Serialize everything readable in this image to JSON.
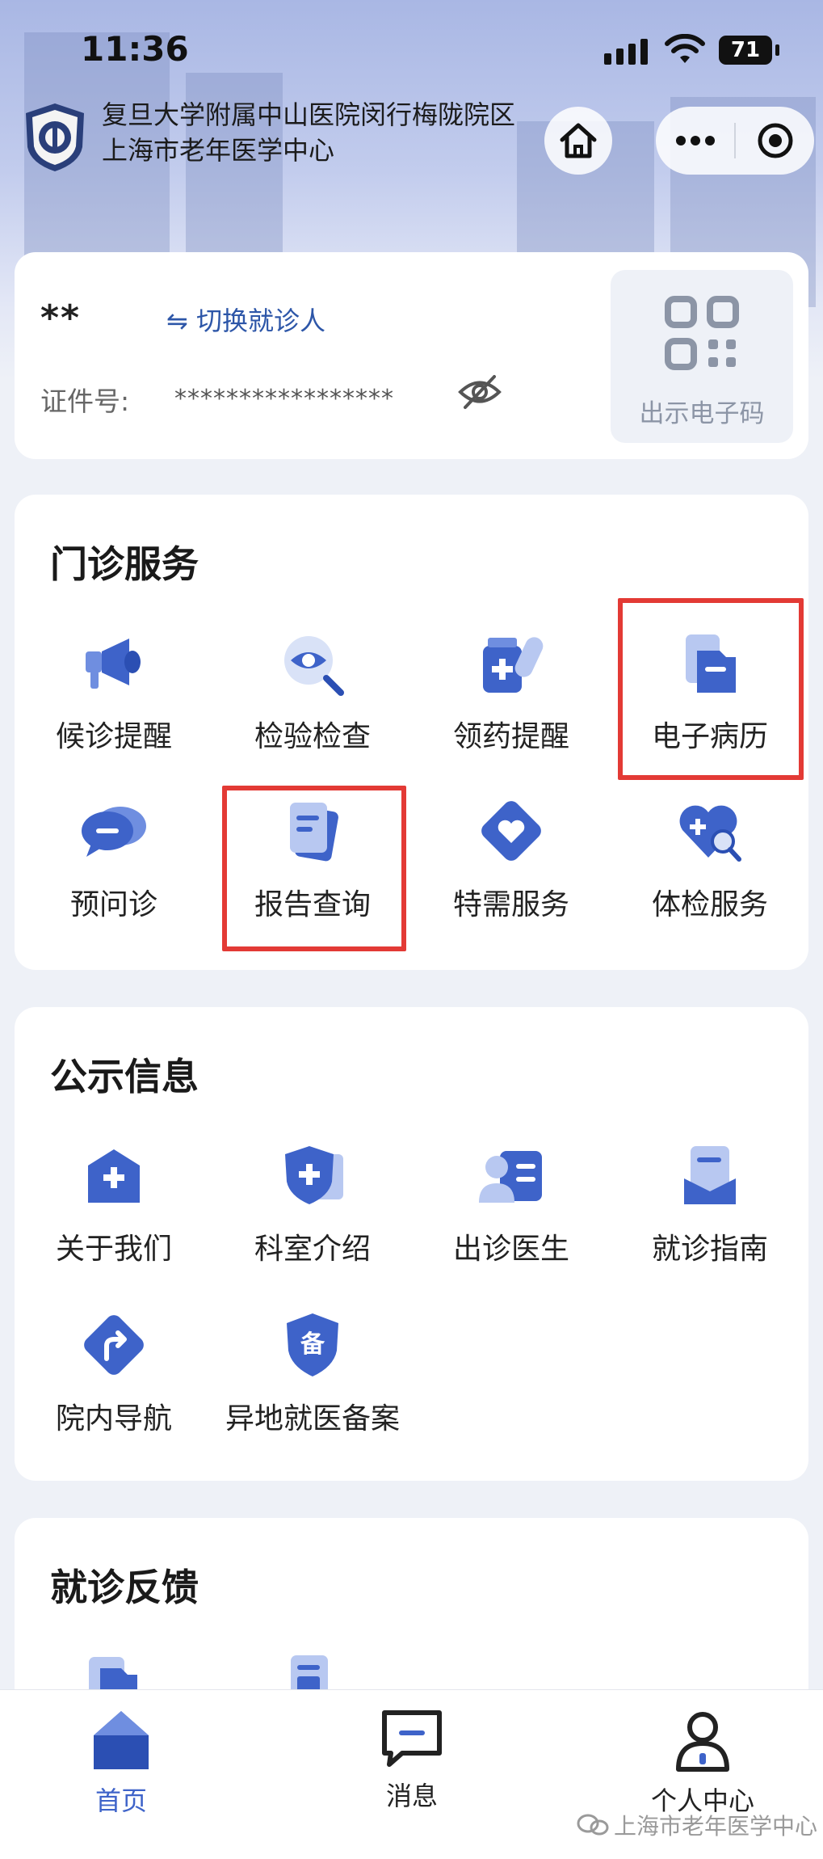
{
  "status_bar": {
    "time": "11:36",
    "battery": "71"
  },
  "header": {
    "hospital_line1": "复旦大学附属中山医院闵行梅陇院区",
    "hospital_line2": "上海市老年医学中心"
  },
  "patient": {
    "name": "**",
    "switch_label": "⇋ 切换就诊人",
    "id_label": "证件号:",
    "id_value": "*****************",
    "qr_label": "出示电子码"
  },
  "outpatient": {
    "title": "门诊服务",
    "items": [
      {
        "label": "候诊提醒",
        "icon": "megaphone-icon"
      },
      {
        "label": "检验检查",
        "icon": "magnifier-eye-icon"
      },
      {
        "label": "领药提醒",
        "icon": "medicine-icon"
      },
      {
        "label": "电子病历",
        "icon": "folder-record-icon"
      },
      {
        "label": "预问诊",
        "icon": "chat-icon"
      },
      {
        "label": "报告查询",
        "icon": "report-icon"
      },
      {
        "label": "特需服务",
        "icon": "heart-diamond-icon"
      },
      {
        "label": "体检服务",
        "icon": "heart-search-icon"
      }
    ]
  },
  "public_info": {
    "title": "公示信息",
    "items": [
      {
        "label": "关于我们",
        "icon": "hospital-icon"
      },
      {
        "label": "科室介绍",
        "icon": "shield-cross-icon"
      },
      {
        "label": "出诊医生",
        "icon": "doctor-icon"
      },
      {
        "label": "就诊指南",
        "icon": "guide-icon"
      },
      {
        "label": "院内导航",
        "icon": "route-icon"
      },
      {
        "label": "异地就医备案",
        "icon": "record-badge-icon"
      }
    ],
    "badge_text": "备"
  },
  "feedback": {
    "title": "就诊反馈"
  },
  "tabbar": {
    "items": [
      {
        "label": "首页",
        "active": true
      },
      {
        "label": "消息",
        "active": false
      },
      {
        "label": "个人中心",
        "active": false
      }
    ]
  },
  "watermark": "上海市老年医学中心",
  "colors": {
    "accent": "#2d56a8",
    "highlight": "#e33a35",
    "icon_blue": "#3e63c9"
  }
}
